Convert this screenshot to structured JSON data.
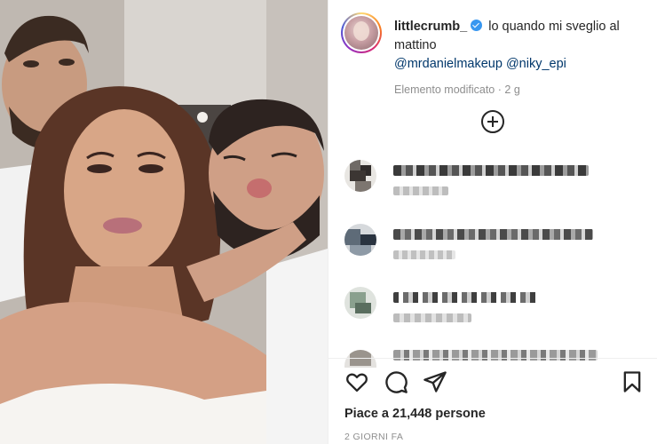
{
  "post": {
    "username": "littlecrumb_",
    "caption": "lo quando mi sveglio al mattino",
    "mentions": "@mrdanielmakeup @niky_epi",
    "edited_label": "Elemento modificato",
    "edited_age": "2 g",
    "likes_text": "Piace a 21,448 persone",
    "date_text": "2 GIORNI FA"
  },
  "icons": {
    "verified": "verified-badge-icon",
    "add": "plus-circle-icon",
    "like": "heart-icon",
    "comment": "comment-bubble-icon",
    "share": "paper-plane-icon",
    "save": "bookmark-icon"
  },
  "colors": {
    "link": "#00376b",
    "verified": "#3897f0",
    "muted": "#8e8e8e",
    "text": "#262626"
  }
}
